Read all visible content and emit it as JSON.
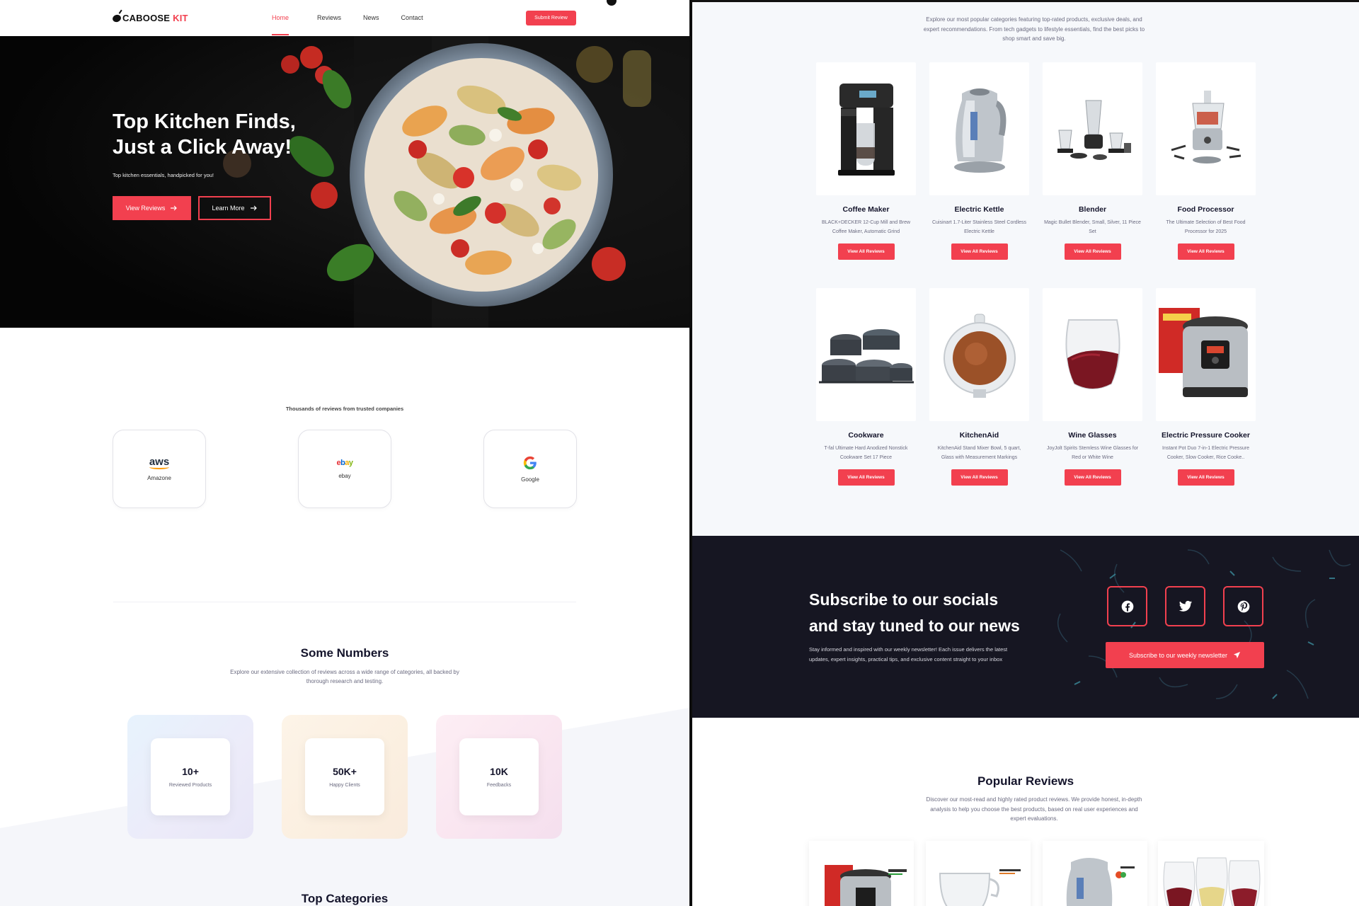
{
  "brand": {
    "name_part1": "CABOOSE",
    "name_part2": "KIT"
  },
  "nav": {
    "links": [
      "Home",
      "Reviews",
      "News",
      "Contact"
    ],
    "submit_label": "Submit Review"
  },
  "hero": {
    "title_line1": "Top Kitchen Finds,",
    "title_line2": "Just a Click Away!",
    "subtitle": "Top kitchen essentials, handpicked for you!",
    "primary_label": "View Reviews",
    "secondary_label": "Learn More"
  },
  "trusted": {
    "title": "Thousands of reviews from trusted companies",
    "companies": [
      {
        "logo_text": "aws",
        "name": "Amazone"
      },
      {
        "logo_text": "ebay",
        "name": "ebay"
      },
      {
        "logo_text": "G",
        "name": "Google"
      }
    ]
  },
  "numbers": {
    "title": "Some Numbers",
    "description": "Explore our extensive collection of reviews across a wide range of categories, all backed by thorough research and testing.",
    "stats": [
      {
        "value": "10+",
        "label": "Reviewed Products"
      },
      {
        "value": "50K+",
        "label": "Happy Clients"
      },
      {
        "value": "10K",
        "label": "Feedbacks"
      }
    ]
  },
  "top_categories": {
    "title": "Top Categories",
    "description": "Explore our most popular categories featuring top-rated products, exclusive deals, and expert recommendations. From tech gadgets to lifestyle essentials, find the best picks to shop smart and save big.",
    "button_label": "View All Reviews",
    "items": [
      {
        "name": "Coffee Maker",
        "desc": "BLACK+DECKER 12-Cup Mill and Brew Coffee Maker, Automatic Grind",
        "icon": "coffee-maker"
      },
      {
        "name": "Electric Kettle",
        "desc": "Cuisinart 1.7-Liter Stainless Steel Cordless Electric Kettle",
        "icon": "kettle"
      },
      {
        "name": "Blender",
        "desc": "Magic Bullet Blender, Small, Silver, 11 Piece Set",
        "icon": "blender"
      },
      {
        "name": "Food Processor",
        "desc": "The Ultimate Selection of Best Food Processor for 2025",
        "icon": "food-processor"
      },
      {
        "name": "Cookware",
        "desc": "T-fal Ultimate Hard Anodized Nonstick Cookware Set 17 Piece",
        "icon": "cookware"
      },
      {
        "name": "KitchenAid",
        "desc": "KitchenAid Stand Mixer Bowl, 5 quart, Glass with Measurement Markings",
        "icon": "mixer-bowl"
      },
      {
        "name": "Wine Glasses",
        "desc": "JoyJolt Spirits Stemless Wine Glasses for Red or White Wine",
        "icon": "wine-glass"
      },
      {
        "name": "Electric Pressure Cooker",
        "desc": "Instant Pot Duo 7-in-1 Electric Pressure Cooker, Slow Cooker, Rice Cooke..",
        "icon": "pressure-cooker"
      }
    ]
  },
  "subscribe": {
    "title_line1": "Subscribe to our socials",
    "title_line2": "and stay tuned to our news",
    "description": "Stay informed and inspired with our weekly newsletter! Each issue delivers the latest updates, expert insights, practical tips, and exclusive content straight to your inbox",
    "button_label": "Subscribe to our weekly newsletter",
    "socials": [
      "facebook",
      "twitter",
      "pinterest"
    ]
  },
  "popular": {
    "title": "Popular Reviews",
    "description": "Discover our most-read and highly rated product reviews. We provide honest, in-depth analysis to help you choose the best products, based on real user experiences and expert evaluations."
  },
  "colors": {
    "accent": "#f2404f",
    "dark": "#161622",
    "text": "#14142b",
    "muted": "#6b6b80"
  }
}
